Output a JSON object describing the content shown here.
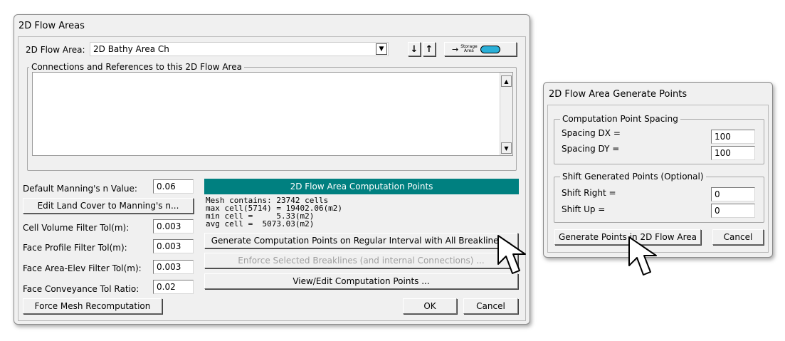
{
  "main_window": {
    "title": "2D Flow Areas",
    "flow_area_label": "2D Flow Area:",
    "flow_area_value": "2D Bathy Area Ch",
    "storage_button_text": "Storage\nArea",
    "connections_label": "Connections and References to this 2D Flow Area",
    "mannings_label": "Default Manning's n Value:",
    "mannings_value": "0.06",
    "edit_land_cover_button": "Edit Land Cover to Manning's n...",
    "cell_volume_label": "Cell Volume Filter Tol(m):",
    "cell_volume_value": "0.003",
    "face_profile_label": "Face Profile Filter Tol(m):",
    "face_profile_value": "0.003",
    "face_area_label": "Face Area-Elev Filter Tol(m):",
    "face_area_value": "0.003",
    "face_conveyance_label": "Face Conveyance Tol Ratio:",
    "face_conveyance_value": "0.02",
    "computation_header": "2D Flow Area Computation Points",
    "mesh_lines": [
      "Mesh contains: 23742 cells",
      "max cell(5714) = 19402.06(m2)",
      "min cell =     5.33(m2)",
      "avg cell =  5073.03(m2)"
    ],
    "generate_button": "Generate Computation Points on Regular Interval with All Breaklines...",
    "enforce_button": "Enforce Selected Breaklines (and internal Connections) ...",
    "view_edit_button": "View/Edit Computation Points ...",
    "force_mesh_button": "Force Mesh Recomputation",
    "ok_button": "OK",
    "cancel_button": "Cancel"
  },
  "generate_window": {
    "title": "2D Flow Area Generate Points",
    "spacing_group": "Computation Point Spacing",
    "spacing_dx_label": "Spacing DX =",
    "spacing_dx_value": "100",
    "spacing_dy_label": "Spacing DY =",
    "spacing_dy_value": "100",
    "shift_group": "Shift Generated Points (Optional)",
    "shift_right_label": "Shift Right =",
    "shift_right_value": "0",
    "shift_up_label": "Shift Up =",
    "shift_up_value": "0",
    "generate_points_button": "Generate Points in 2D Flow Area",
    "cancel_button": "Cancel"
  },
  "colors": {
    "header_bar": "#008080",
    "storage_icon": "#2ab0d8"
  }
}
